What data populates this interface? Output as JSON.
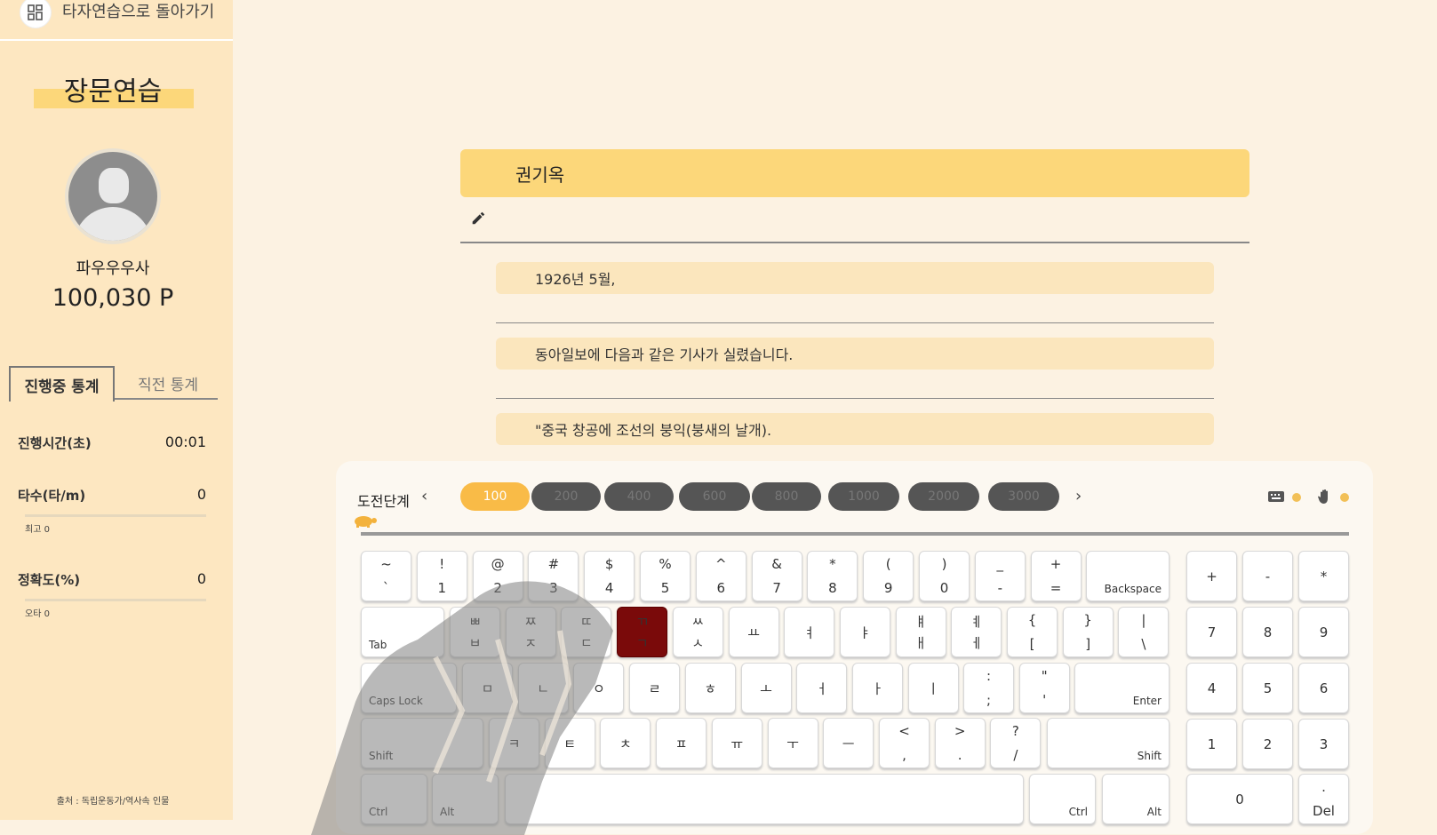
{
  "sidebar": {
    "back_label": "타자연습으로 돌아가기",
    "title": "장문연습",
    "username": "파우우우사",
    "points": "100,030 P",
    "tabs": [
      "진행중 통계",
      "직전 통계"
    ],
    "stats": [
      {
        "label": "진행시간(초)",
        "value": "00:01",
        "sub": ""
      },
      {
        "label": "타수(타/m)",
        "value": "0",
        "sub": "최고 0"
      },
      {
        "label": "정확도(%)",
        "value": "0",
        "sub": "오타 0"
      }
    ],
    "source": "출처 : 독립운동가/역사속 인물"
  },
  "main": {
    "title": "권기옥",
    "lines": [
      "1926년 5월,",
      "동아일보에 다음과 같은 기사가 실렸습니다.",
      "\"중국 창공에 조선의 붕익(붕새의 날개)."
    ]
  },
  "keyboard": {
    "level_label": "도전단계",
    "levels": [
      "100",
      "200",
      "400",
      "600",
      "800",
      "1000",
      "2000",
      "3000"
    ],
    "active_level": "100",
    "row1": [
      [
        "~",
        "`"
      ],
      [
        "!",
        "1"
      ],
      [
        "@",
        "2"
      ],
      [
        "#",
        "3"
      ],
      [
        "$",
        "4"
      ],
      [
        "%",
        "5"
      ],
      [
        "^",
        "6"
      ],
      [
        "&",
        "7"
      ],
      [
        "*",
        "8"
      ],
      [
        "(",
        "9"
      ],
      [
        ")",
        "0"
      ],
      [
        "_",
        "-"
      ],
      [
        "+",
        "="
      ]
    ],
    "backspace": "Backspace",
    "tab": "Tab",
    "row2": [
      [
        "ㅃ",
        "ㅂ"
      ],
      [
        "ㅉ",
        "ㅈ"
      ],
      [
        "ㄸ",
        "ㄷ"
      ],
      [
        "ㄲ",
        "ㄱ"
      ],
      [
        "ㅆ",
        "ㅅ"
      ],
      [
        "",
        "ㅛ"
      ],
      [
        "",
        "ㅕ"
      ],
      [
        "",
        "ㅑ"
      ],
      [
        "ㅒ",
        "ㅐ"
      ],
      [
        "ㅖ",
        "ㅔ"
      ],
      [
        "{",
        "["
      ],
      [
        "}",
        "]"
      ],
      [
        "|",
        "\\"
      ]
    ],
    "caps": "Caps Lock",
    "row3": [
      "ㅁ",
      "ㄴ",
      "ㅇ",
      "ㄹ",
      "ㅎ",
      "ㅗ",
      "ㅓ",
      "ㅏ",
      "ㅣ"
    ],
    "row3_sym": [
      [
        ":",
        ";"
      ],
      [
        "\"",
        "'"
      ]
    ],
    "enter": "Enter",
    "shift": "Shift",
    "row4": [
      "ㅋ",
      "ㅌ",
      "ㅊ",
      "ㅍ",
      "ㅠ",
      "ㅜ",
      "ㅡ"
    ],
    "row4_sym": [
      [
        "<",
        ","
      ],
      [
        ">",
        "."
      ],
      [
        "?",
        "/"
      ]
    ],
    "ctrl": "Ctrl",
    "alt": "Alt",
    "numpad": [
      [
        "+",
        "-",
        "*"
      ],
      [
        "7",
        "8",
        "9"
      ],
      [
        "4",
        "5",
        "6"
      ],
      [
        "1",
        "2",
        "3"
      ]
    ],
    "numpad_zero": "0",
    "numpad_del_top": ".",
    "numpad_del": "Del"
  }
}
